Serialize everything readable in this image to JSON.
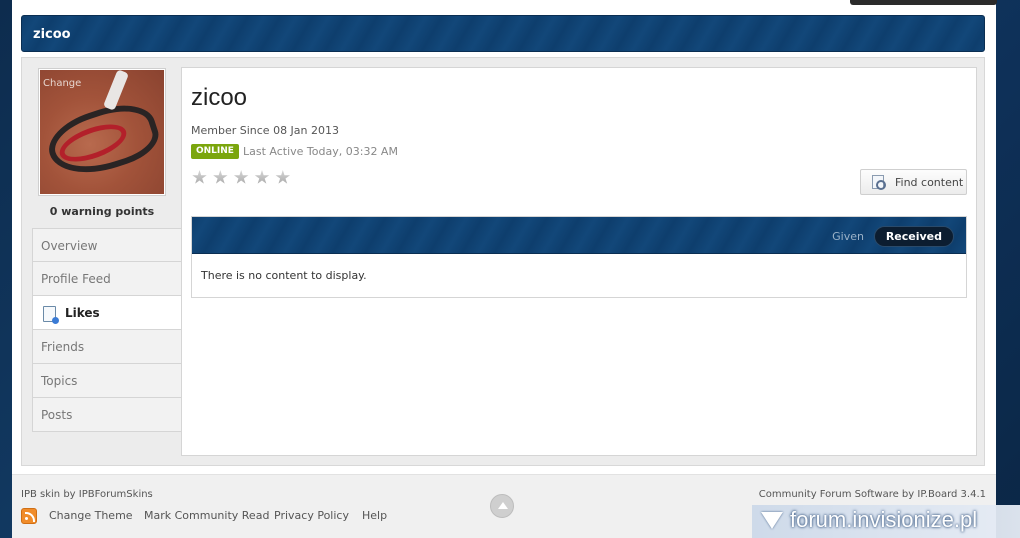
{
  "title_bar": {
    "title": "zicoo"
  },
  "avatar": {
    "change_label": "Change"
  },
  "warning_points": "0 warning points",
  "sidebar": {
    "tabs": [
      {
        "label": "Overview",
        "active": false
      },
      {
        "label": "Profile Feed",
        "active": false
      },
      {
        "label": "Likes",
        "active": true
      },
      {
        "label": "Friends",
        "active": false
      },
      {
        "label": "Topics",
        "active": false
      },
      {
        "label": "Posts",
        "active": false
      }
    ]
  },
  "profile": {
    "username": "zicoo",
    "member_since": "Member Since 08 Jan 2013",
    "online_badge": "ONLINE",
    "last_active": "Last Active Today, 03:32 AM",
    "rating_stars_filled": 0,
    "rating_stars_total": 5,
    "find_content_label": "Find content"
  },
  "likes": {
    "tab_given": "Given",
    "tab_received": "Received",
    "active_tab": "Received",
    "empty_message": "There is no content to display."
  },
  "footer": {
    "skin_credit": "IPB skin by IPBForumSkins",
    "links": [
      "Change Theme",
      "Mark Community Read",
      "Privacy Policy",
      "Help"
    ],
    "software_credit": "Community Forum Software by IP.Board 3.4.1"
  },
  "watermark": {
    "text": "forum.invisionize.pl"
  },
  "colors": {
    "header_blue": "#124779",
    "online_green": "#7ba60d",
    "background_navy": "#0d2c4e"
  }
}
